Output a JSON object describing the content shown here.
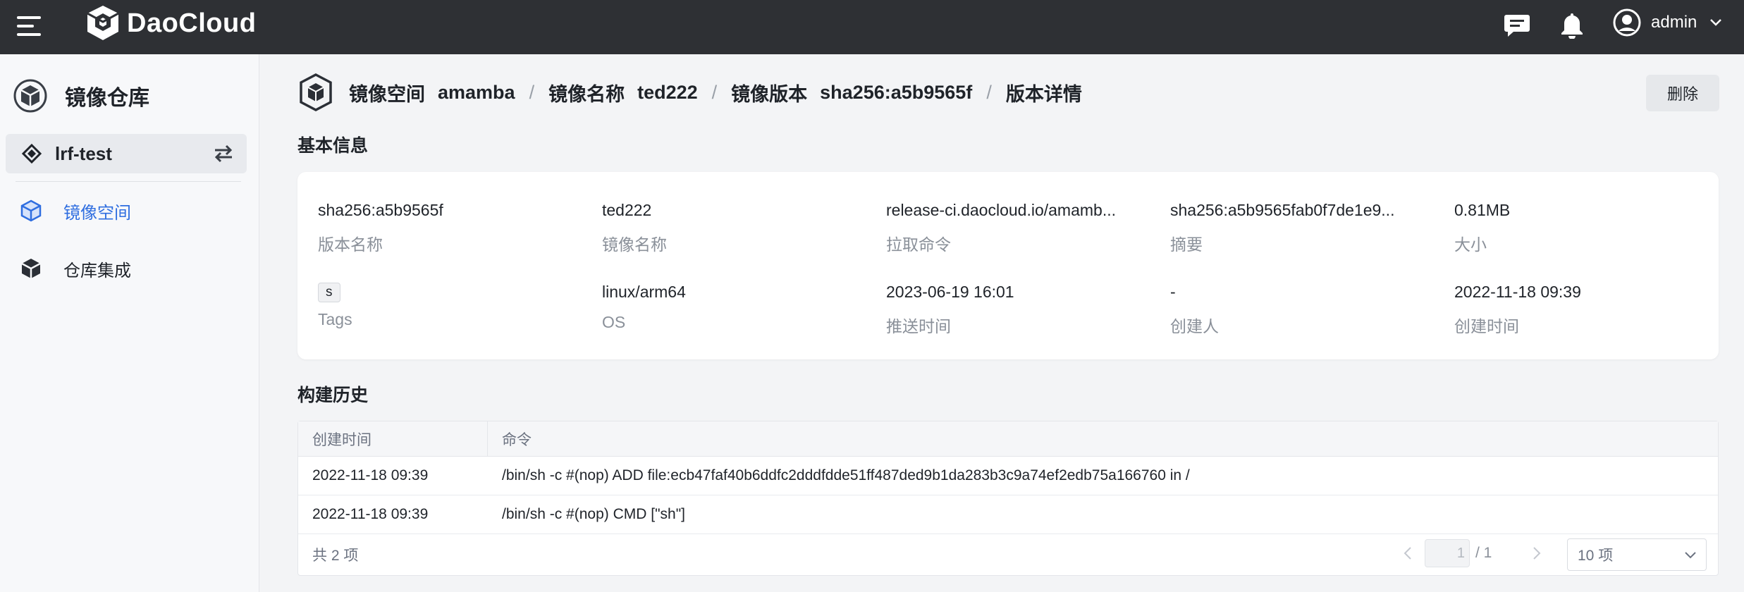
{
  "topbar": {
    "brand": "DaoCloud",
    "user_name": "admin"
  },
  "sidebar": {
    "title": "镜像仓库",
    "workspace": "lrf-test",
    "items": [
      {
        "label": "镜像空间",
        "icon": "cube-outline-icon",
        "active": true
      },
      {
        "label": "仓库集成",
        "icon": "cube-solid-icon",
        "active": false
      }
    ]
  },
  "breadcrumb": {
    "space_label": "镜像空间",
    "space_value": "amamba",
    "image_label": "镜像名称",
    "image_value": "ted222",
    "version_label": "镜像版本",
    "version_value": "sha256:a5b9565f",
    "current": "版本详情",
    "separator": "/"
  },
  "actions": {
    "delete_label": "删除"
  },
  "basic_info": {
    "title": "基本信息",
    "fields": [
      {
        "value": "sha256:a5b9565f",
        "label": "版本名称"
      },
      {
        "value": "ted222",
        "label": "镜像名称"
      },
      {
        "value": "release-ci.daocloud.io/amamb...",
        "label": "拉取命令"
      },
      {
        "value": "sha256:a5b9565fab0f7de1e9...",
        "label": "摘要"
      },
      {
        "value": "0.81MB",
        "label": "大小"
      },
      {
        "value": "s",
        "label": "Tags"
      },
      {
        "value": "linux/arm64",
        "label": "OS"
      },
      {
        "value": "2023-06-19 16:01",
        "label": "推送时间"
      },
      {
        "value": "-",
        "label": "创建人"
      },
      {
        "value": "2022-11-18 09:39",
        "label": "创建时间"
      }
    ]
  },
  "build_history": {
    "title": "构建历史",
    "columns": [
      "创建时间",
      "命令"
    ],
    "rows": [
      [
        "2022-11-18 09:39",
        "/bin/sh -c #(nop) ADD file:ecb47faf40b6ddfc2dddfdde51ff487ded9b1da283b3c9a74ef2edb75a166760 in /"
      ],
      [
        "2022-11-18 09:39",
        "/bin/sh -c #(nop) CMD [\"sh\"]"
      ]
    ],
    "total_text": "共 2 项",
    "page_current": "1",
    "page_total": "/ 1",
    "page_size": "10 项"
  },
  "colors": {
    "topbar_bg": "#2e3034",
    "accent": "#2f6ee0",
    "sidebar_bg": "#f7f8fa",
    "page_bg": "#f3f4f6"
  }
}
